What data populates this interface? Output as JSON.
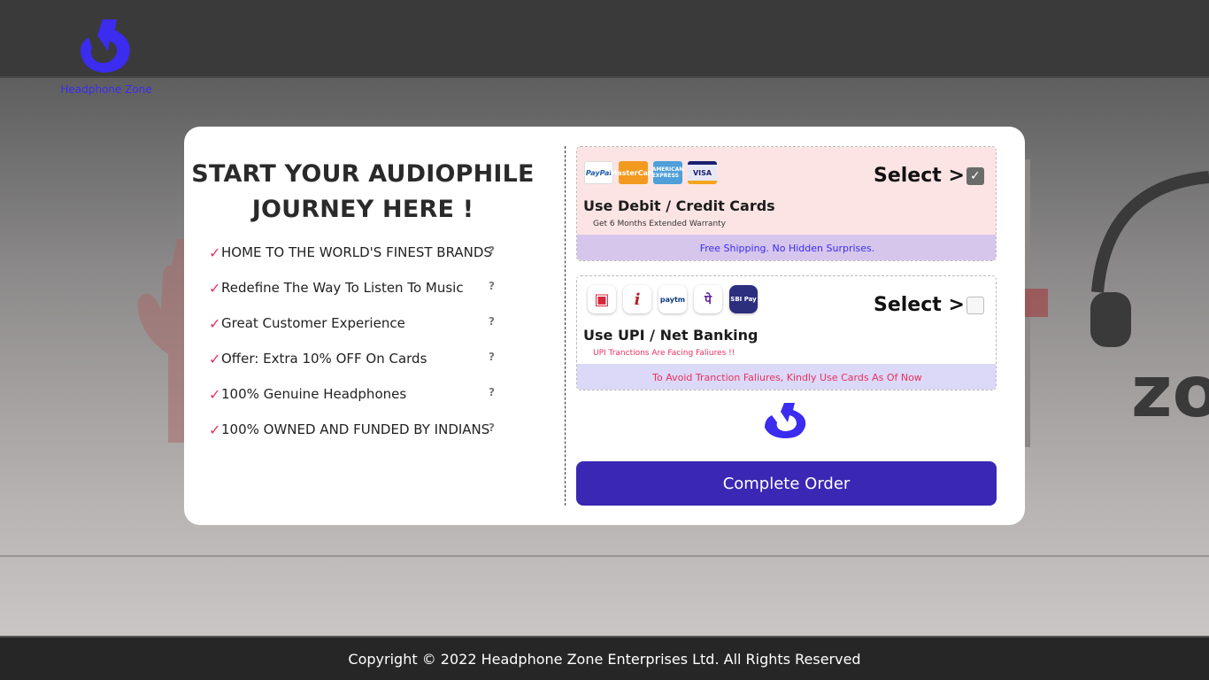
{
  "header": {
    "brand_name": "Headphone Zone",
    "logo_icon": "headphone-zone-logo-icon",
    "brand_color": "#3b2cf0"
  },
  "modal": {
    "headline": "START YOUR AUDIOPHILE JOURNEY HERE !",
    "features": [
      {
        "text": "HOME TO THE WORLD'S FINEST BRANDS",
        "help": "?"
      },
      {
        "text": "Redefine The Way To Listen To Music",
        "help": "?"
      },
      {
        "text": "Great Customer Experience",
        "help": "?"
      },
      {
        "text": "Offer: Extra 10% OFF On Cards",
        "help": "?"
      },
      {
        "text": "100% Genuine Headphones",
        "help": "?"
      },
      {
        "text": "100% OWNED AND FUNDED BY INDIANS",
        "help": "?"
      }
    ],
    "check_mark": "✓",
    "payment_options": [
      {
        "title": "Use Debit / Credit Cards",
        "subtitle": "Get 6 Months Extended Warranty",
        "select_label": "Select >",
        "checked": true,
        "footer": "Free Shipping. No Hidden Surprises.",
        "icons": [
          {
            "name": "paypal-icon",
            "label": "PayPal"
          },
          {
            "name": "mastercard-icon",
            "label": "MasterCard"
          },
          {
            "name": "amex-icon",
            "label": "AMERICAN EXPRESS"
          },
          {
            "name": "visa-icon",
            "label": "VISA"
          }
        ]
      },
      {
        "title": "Use UPI / Net Banking",
        "subtitle": "UPI Tranctions Are Facing Faliures !!",
        "select_label": "Select >",
        "checked": false,
        "footer": "To Avoid Tranction Faliures, Kindly Use Cards As Of Now",
        "icons": [
          {
            "name": "hdfc-bank-icon",
            "label": "▣"
          },
          {
            "name": "icici-bank-icon",
            "label": "i"
          },
          {
            "name": "paytm-icon",
            "label": "paytm"
          },
          {
            "name": "phonepe-icon",
            "label": "पे"
          },
          {
            "name": "sbi-pay-icon",
            "label": "SBI Pay"
          }
        ]
      }
    ],
    "complete_button": "Complete Order"
  },
  "footer": {
    "copyright": "Copyright © 2022 Headphone Zone Enterprises Ltd. All Rights Reserved"
  },
  "colors": {
    "accent": "#3a27b3",
    "check_red": "#e8315f",
    "card_pink": "#fce4e4",
    "footer_bg": "#262626"
  }
}
